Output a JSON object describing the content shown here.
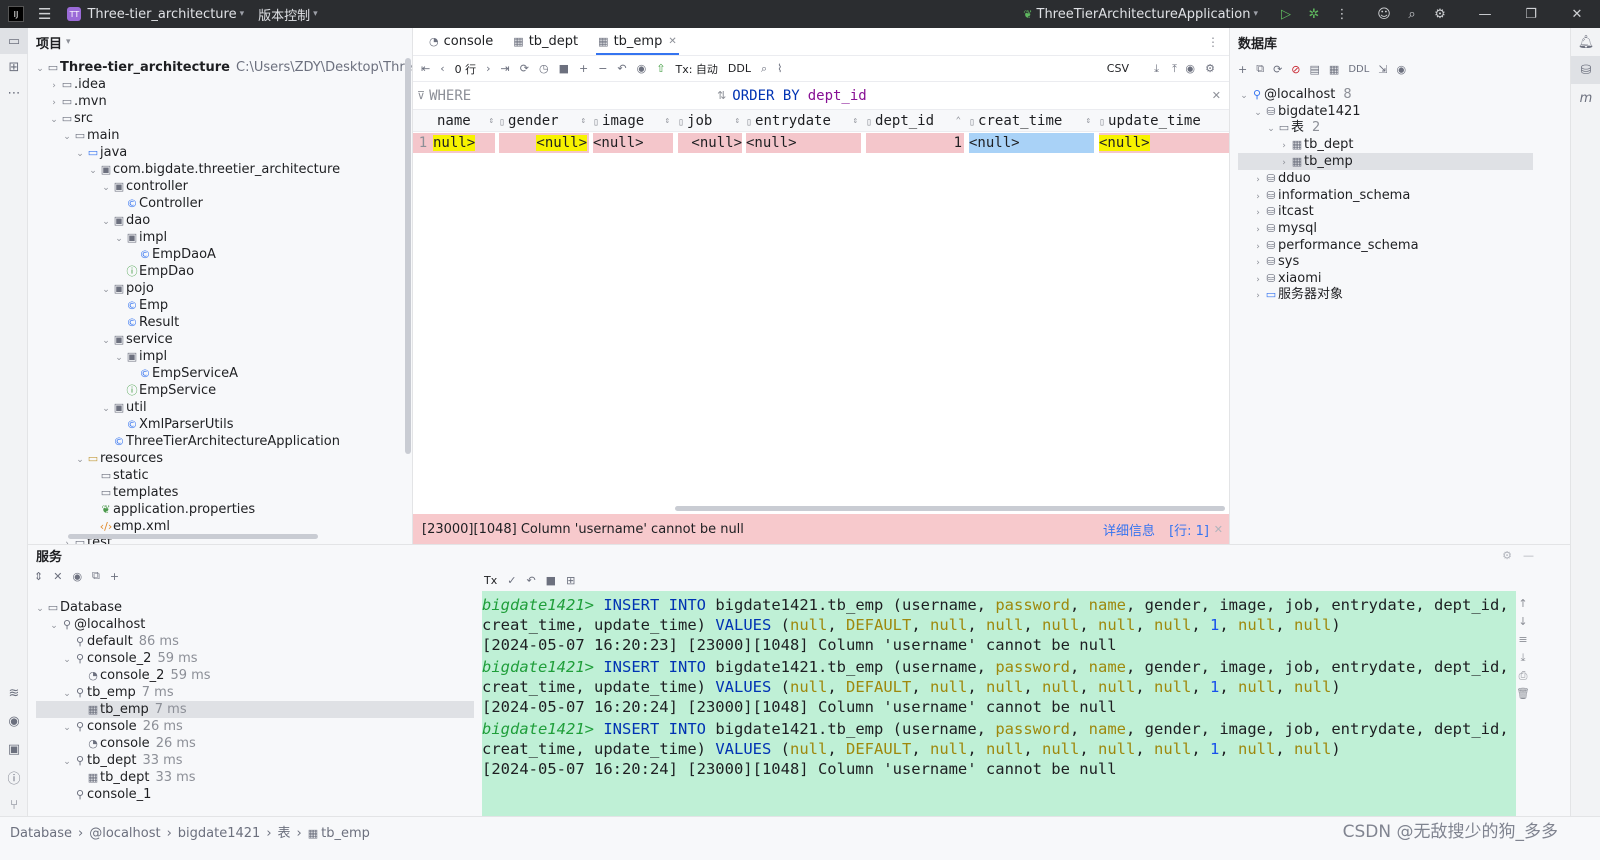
{
  "titlebar": {
    "project_badge": "TT",
    "project_name": "Three-tier_architecture",
    "vcs_label": "版本控制",
    "run_config": "ThreeTierArchitectureApplication"
  },
  "project_panel": {
    "title": "项目",
    "root_name": "Three-tier_architecture",
    "root_path": "C:\\Users\\ZDY\\Desktop\\Three-tie",
    "nodes": [
      {
        "label": ".idea"
      },
      {
        "label": ".mvn"
      },
      {
        "label": "src"
      },
      {
        "label": "main"
      },
      {
        "label": "java"
      },
      {
        "label": "com.bigdate.threetier_architecture"
      },
      {
        "label": "controller"
      },
      {
        "label": "Controller"
      },
      {
        "label": "dao"
      },
      {
        "label": "impl"
      },
      {
        "label": "EmpDaoA"
      },
      {
        "label": "EmpDao"
      },
      {
        "label": "pojo"
      },
      {
        "label": "Emp"
      },
      {
        "label": "Result"
      },
      {
        "label": "service"
      },
      {
        "label": "impl"
      },
      {
        "label": "EmpServiceA"
      },
      {
        "label": "EmpService"
      },
      {
        "label": "util"
      },
      {
        "label": "XmlParserUtils"
      },
      {
        "label": "ThreeTierArchitectureApplication"
      },
      {
        "label": "resources"
      },
      {
        "label": "static"
      },
      {
        "label": "templates"
      },
      {
        "label": "application.properties"
      },
      {
        "label": "emp.xml"
      },
      {
        "label": "test"
      }
    ]
  },
  "editor": {
    "tabs": [
      {
        "label": "console"
      },
      {
        "label": "tb_dept"
      },
      {
        "label": "tb_emp"
      }
    ],
    "toolbar": {
      "rows_label": "0 行",
      "tx_label": "Tx: 自动",
      "ddl_label": "DDL",
      "csv_label": "CSV"
    },
    "filter": {
      "where_label": "WHERE",
      "order_kw": "ORDER BY",
      "order_col": "dept_id"
    },
    "columns": [
      "name",
      "gender",
      "image",
      "job",
      "entrydate",
      "dept_id",
      "creat_time",
      "update_time"
    ],
    "row": {
      "num": "1",
      "name": "null>",
      "gender": "<null>",
      "image": "<null>",
      "job": "<null>",
      "entrydate": "<null>",
      "dept_id": "1",
      "creat_time": "<null>",
      "update_time": "<null>"
    },
    "error": {
      "message": "[23000][1048] Column 'username' cannot be null",
      "details": "详细信息",
      "row_info": "[行: 1]"
    }
  },
  "db_panel": {
    "title": "数据库",
    "ddl_label": "DDL",
    "host": "@localhost",
    "host_count": "8",
    "schema": "bigdate1421",
    "tables_label": "表",
    "tables_count": "2",
    "tables": [
      "tb_dept",
      "tb_emp"
    ],
    "schemas": [
      "dduo",
      "information_schema",
      "itcast",
      "mysql",
      "performance_schema",
      "sys",
      "xiaomi"
    ],
    "server_objects": "服务器对象"
  },
  "services": {
    "title": "服务",
    "tree": [
      {
        "label": "Database",
        "dur": ""
      },
      {
        "label": "@localhost",
        "dur": ""
      },
      {
        "label": "default",
        "dur": "86 ms"
      },
      {
        "label": "console_2",
        "dur": "59 ms"
      },
      {
        "label": "console_2",
        "dur": "59 ms"
      },
      {
        "label": "tb_emp",
        "dur": "7 ms"
      },
      {
        "label": "tb_emp",
        "dur": "7 ms"
      },
      {
        "label": "console",
        "dur": "26 ms"
      },
      {
        "label": "console",
        "dur": "26 ms"
      },
      {
        "label": "tb_dept",
        "dur": "33 ms"
      },
      {
        "label": "tb_dept",
        "dur": "33 ms"
      },
      {
        "label": "console_1",
        "dur": ""
      }
    ],
    "console_tx": "Tx",
    "prompt": "bigdate1421>",
    "insert_kw": "INSERT",
    "into_kw": "INTO",
    "table": "bigdate1421.tb_emp",
    "cols_line1": [
      "username",
      "password",
      "name",
      "gender",
      "image",
      "job",
      "entrydate",
      "dept_id"
    ],
    "cols_line2": [
      "creat_time",
      "update_time"
    ],
    "values_kw": "VALUES",
    "values": [
      "null",
      "DEFAULT",
      "null",
      "null",
      "null",
      "null",
      "null",
      "1",
      "null",
      "null"
    ],
    "errors": [
      "[2024-05-07 16:20:23] [23000][1048] Column 'username' cannot be null",
      "[2024-05-07 16:20:24] [23000][1048] Column 'username' cannot be null",
      "[2024-05-07 16:20:24] [23000][1048] Column 'username' cannot be null"
    ]
  },
  "statusbar": {
    "crumbs": [
      "Database",
      "@localhost",
      "bigdate1421",
      "表",
      "tb_emp"
    ],
    "watermark": "CSDN @无敌搜少的狗_多多"
  }
}
